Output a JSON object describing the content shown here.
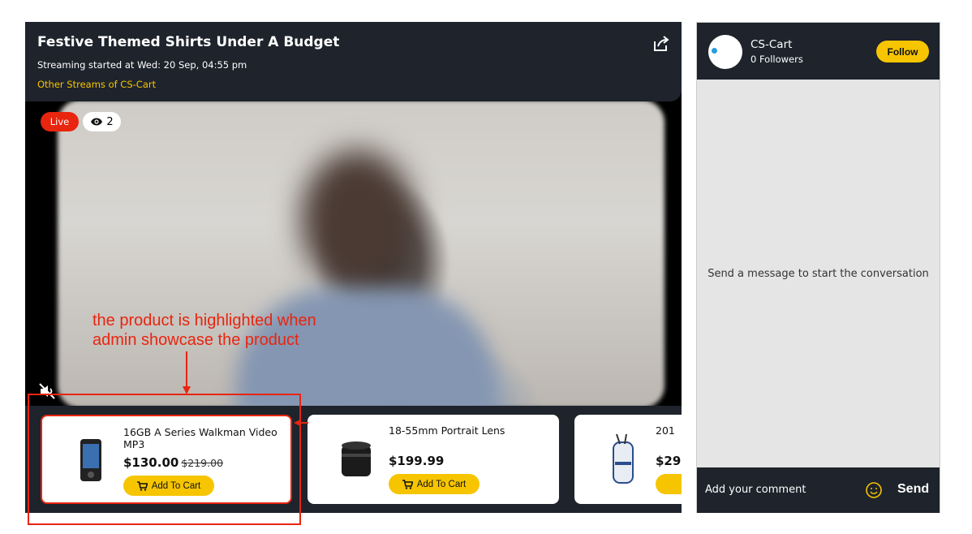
{
  "stream": {
    "title": "Festive Themed Shirts Under A Budget",
    "started": "Streaming started at Wed: 20 Sep, 04:55 pm",
    "other_streams": "Other Streams of CS-Cart",
    "live_label": "Live",
    "viewer_count": "2"
  },
  "products": [
    {
      "name": "16GB A Series Walkman Video MP3",
      "price": "$130.00",
      "old_price": "$219.00",
      "cta": "Add To Cart",
      "highlighted": true
    },
    {
      "name": "18-55mm Portrait Lens",
      "price": "$199.99",
      "old_price": "",
      "cta": "Add To Cart",
      "highlighted": false
    },
    {
      "name": "201",
      "price": "$29",
      "old_price": "",
      "cta": "",
      "highlighted": false
    }
  ],
  "annotation": {
    "text_line1": "the product is highlighted when",
    "text_line2": "admin showcase the product"
  },
  "chat": {
    "store_name": "CS-Cart",
    "followers": "0 Followers",
    "follow_label": "Follow",
    "empty_message": "Send a message to start the conversation",
    "comment_placeholder": "Add your comment",
    "send_label": "Send"
  },
  "colors": {
    "accent_yellow": "#f6c500",
    "live_red": "#e8250f",
    "dark_panel": "#1e232c"
  }
}
